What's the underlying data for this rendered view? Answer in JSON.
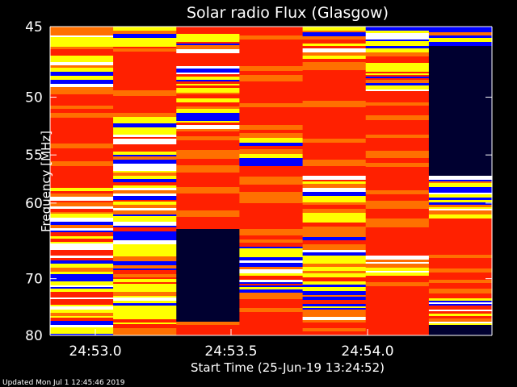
{
  "footer": "Updated Mon Jul  1 12:45:46 2019",
  "chart_data": {
    "type": "heatmap",
    "title": "Solar radio Flux (Glasgow)",
    "xlabel": "Start Time (25-Jun-19 13:24:52)",
    "ylabel": "Frequency [MHz]",
    "x_ticks": [
      "24:53.0",
      "24:53.5",
      "24:54.0"
    ],
    "y_ticks": [
      "45",
      "50",
      "55",
      "60",
      "70",
      "80"
    ],
    "y_tick_values": [
      45,
      50,
      55,
      60,
      70,
      80
    ],
    "ylim": [
      45,
      80
    ],
    "y_scale": "reciprocal",
    "colormap": [
      "#000030",
      "#0000ff",
      "#ff2000",
      "#ff7000",
      "#ffff00",
      "#ffffff"
    ],
    "grid": false,
    "time_columns": 7
  }
}
